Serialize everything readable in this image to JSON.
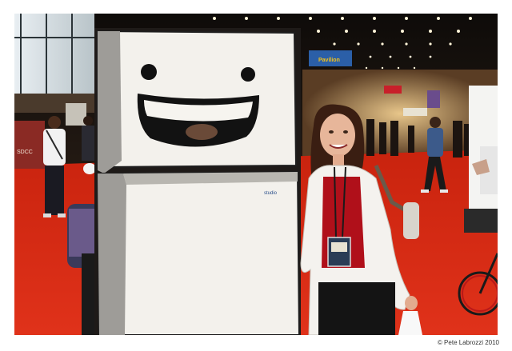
{
  "photo": {
    "description_icon": "convention-photo",
    "colors": {
      "carpet": "#d42a10",
      "ceiling": "#1a1410",
      "fridge": "#f2efe8",
      "fridge_outline": "#222222",
      "shirt": "#b0101a",
      "jacket": "#f4f2ee"
    }
  },
  "sign": {
    "text": "Pavilion"
  },
  "booth": {
    "text": "SDCC"
  },
  "fridge": {
    "logo": "studio"
  },
  "credit": "© Pete Labrozzi 2010"
}
